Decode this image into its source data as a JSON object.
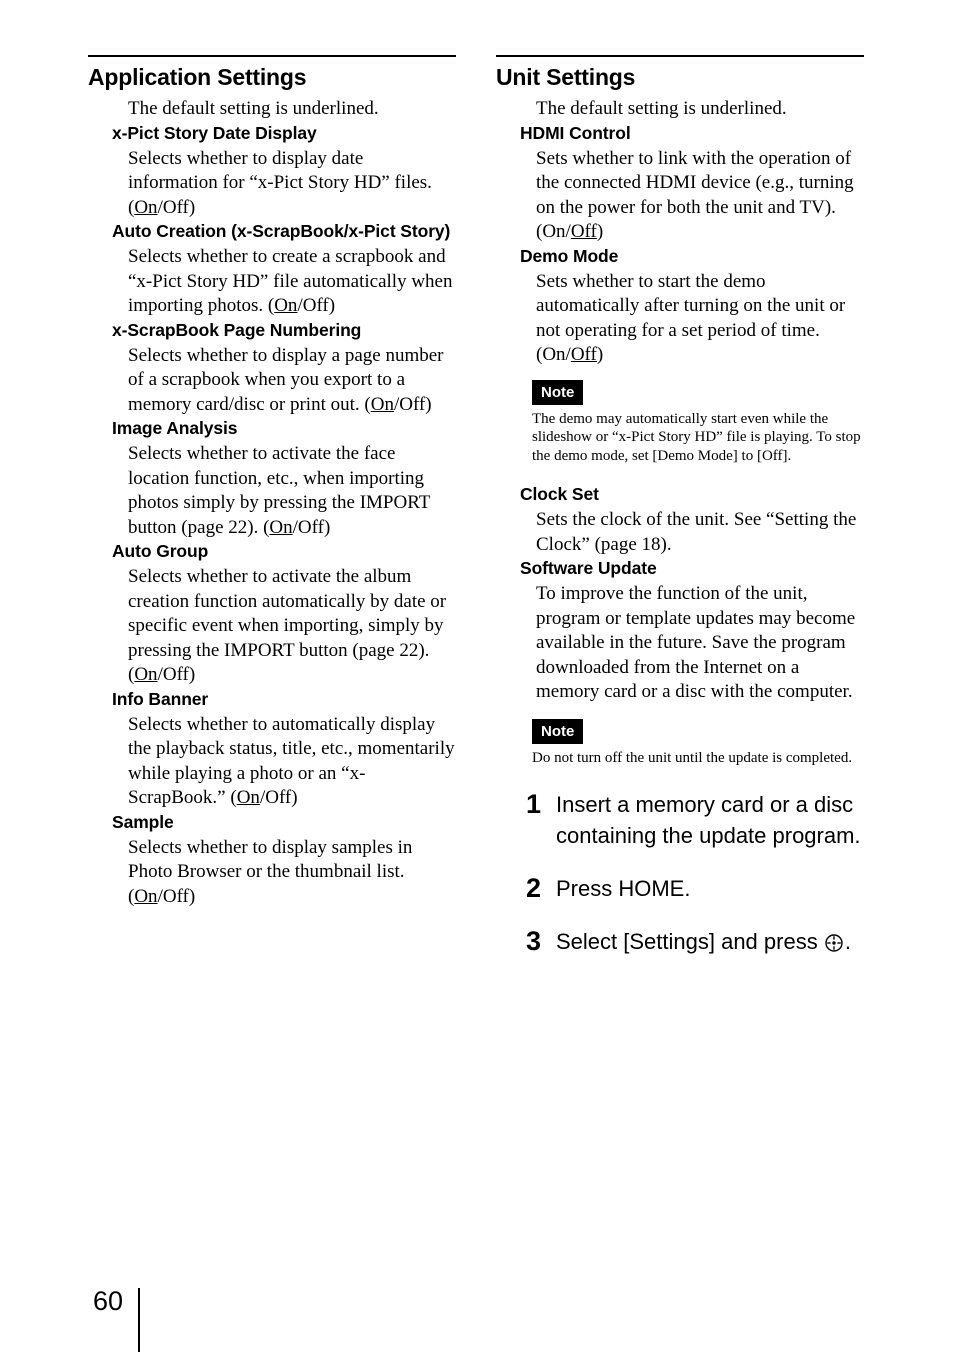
{
  "page": {
    "number": "60"
  },
  "left_column": {
    "section_title": "Application Settings",
    "lead": "The default setting is underlined.",
    "entries": [
      {
        "title": "x-Pict Story Date Display",
        "body_pre": "Selects whether to display date information for “x-Pict Story HD” files. (",
        "default_option": "On",
        "body_post": "/Off)"
      },
      {
        "title": "Auto Creation (x-ScrapBook/x-Pict Story)",
        "body_pre": "Selects whether to create a scrapbook and “x-Pict Story HD” file automatically when importing photos. (",
        "default_option": "On",
        "body_post": "/Off)"
      },
      {
        "title": "x-ScrapBook Page Numbering",
        "body_pre": "Selects whether to display a page number of a scrapbook when you export to a memory card/disc or print out. (",
        "default_option": "On",
        "body_post": "/Off)"
      },
      {
        "title": "Image Analysis",
        "body_pre": "Selects whether to activate the face location function, etc., when importing photos simply by pressing the IMPORT button (page 22). (",
        "default_option": "On",
        "body_post": "/Off)"
      },
      {
        "title": "Auto Group",
        "body_pre": "Selects whether to activate the album creation function automatically by date or specific event when importing, simply by pressing the IMPORT button (page 22). (",
        "default_option": "On",
        "body_post": "/Off)"
      },
      {
        "title": "Info Banner",
        "body_pre": "Selects whether to automatically display the playback status, title, etc., momentarily while playing a photo or an “x-ScrapBook.” (",
        "default_option": "On",
        "body_post": "/Off)"
      },
      {
        "title": "Sample",
        "body_pre": "Selects whether to display samples in Photo Browser or the thumbnail list. (",
        "default_option": "On",
        "body_post": "/Off)"
      }
    ]
  },
  "right_column": {
    "section_title": "Unit Settings",
    "lead": "The default setting is underlined.",
    "hdmi": {
      "title": "HDMI Control",
      "body_pre": "Sets whether to link with the operation of the connected HDMI device (e.g., turning on the power for both the unit and TV). (On/",
      "default_option": "Off",
      "body_post": ")"
    },
    "demo": {
      "title": "Demo Mode",
      "body_pre": "Sets whether to start the demo automatically after turning on the unit or not operating for a set period of time. (On/",
      "default_option": "Off",
      "body_post": ")",
      "note_label": "Note",
      "note_text": "The demo may automatically start even while the slideshow or “x-Pict Story HD” file is playing. To stop the demo mode, set [Demo Mode] to [Off]."
    },
    "clock": {
      "title": "Clock Set",
      "body": "Sets the clock of the unit. See “Setting the Clock” (page 18)."
    },
    "software_update": {
      "title": "Software Update",
      "body": "To improve the function of the unit, program or template updates may become available in the future. Save the program downloaded from the Internet on a memory card or a disc with the computer.",
      "note_label": "Note",
      "note_text": "Do not turn off the unit until the update is completed.",
      "steps": [
        {
          "number": "1",
          "text": "Insert a memory card or a disc containing the update program."
        },
        {
          "number": "2",
          "text": "Press HOME."
        },
        {
          "number": "3",
          "text_pre": "Select [Settings] and press ",
          "glyph": "enter-button-icon",
          "text_post": "."
        }
      ]
    }
  }
}
